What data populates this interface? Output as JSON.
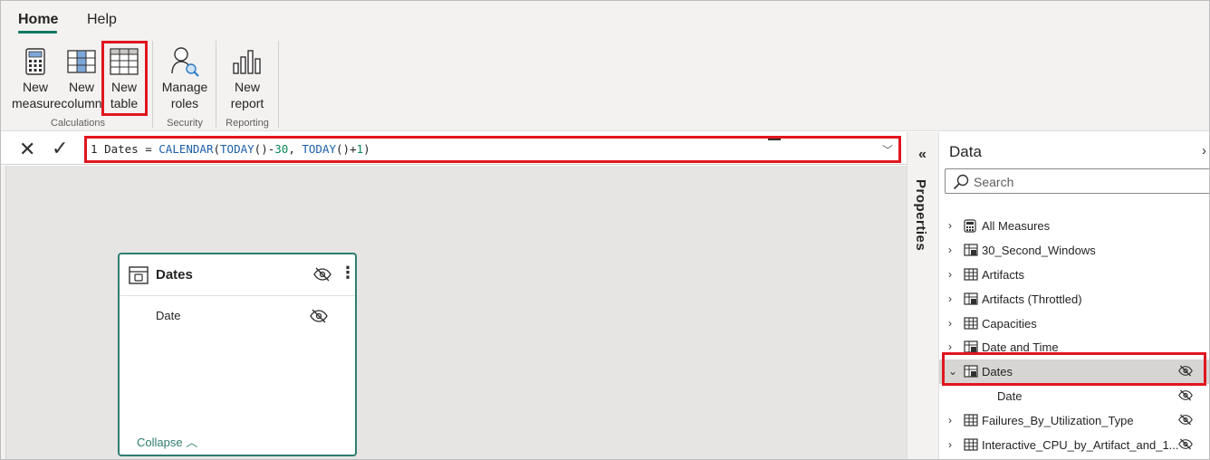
{
  "ribbon": {
    "tabs": [
      {
        "label": "Home",
        "active": true
      },
      {
        "label": "Help",
        "active": false
      }
    ],
    "buttons": {
      "new_measure": "New\nmeasure",
      "new_column": "New\ncolumn",
      "new_table": "New\ntable",
      "manage_roles": "Manage\nroles",
      "new_report": "New\nreport"
    },
    "groups": {
      "calculations": "Calculations",
      "security": "Security",
      "reporting": "Reporting"
    }
  },
  "formula_bar": {
    "line_number": "1",
    "table_name": "Dates",
    "equals": " = ",
    "fn_calendar": "CALENDAR",
    "fn_today": "TODAY",
    "offset_start": "30",
    "offset_end": "1"
  },
  "canvas": {
    "card": {
      "title": "Dates",
      "field": "Date",
      "collapse": "Collapse"
    }
  },
  "properties": {
    "label": "Properties"
  },
  "data_pane": {
    "title": "Data",
    "search_placeholder": "Search",
    "items": [
      {
        "label": "All Measures",
        "icon": "calculator-icon"
      },
      {
        "label": "30_Second_Windows",
        "icon": "calc-table-icon"
      },
      {
        "label": "Artifacts",
        "icon": "table-icon"
      },
      {
        "label": "Artifacts (Throttled)",
        "icon": "calc-table-icon"
      },
      {
        "label": "Capacities",
        "icon": "table-icon"
      },
      {
        "label": "Date and Time",
        "icon": "calc-table-icon"
      },
      {
        "label": "Dates",
        "icon": "calc-table-icon",
        "expanded": true,
        "selected": true
      },
      {
        "label": "Date",
        "child": true
      },
      {
        "label": "Failures_By_Utilization_Type",
        "icon": "table-icon"
      },
      {
        "label": "Interactive_CPU_by_Artifact_and_1...",
        "icon": "table-icon"
      }
    ]
  },
  "colors": {
    "accent": "#117865",
    "highlight": "#e0161f",
    "card_border": "#2e7d6f",
    "function": "#1c5fa8",
    "number": "#098658"
  }
}
